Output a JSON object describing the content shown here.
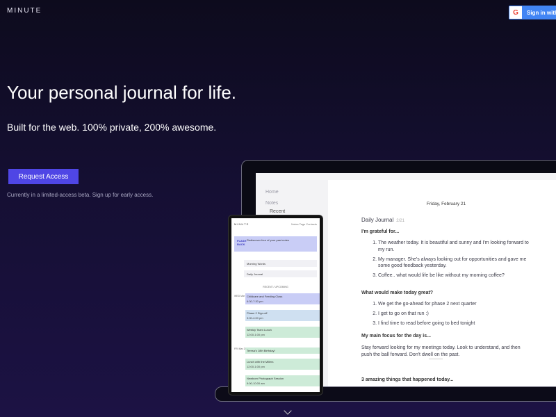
{
  "brand": "MINUTE",
  "signin": {
    "g": "G",
    "label": "Sign in with G"
  },
  "hero": {
    "title": "Your personal journal for life.",
    "subtitle": "Built for the web. 100% private, 200% awesome.",
    "cta": "Request Access",
    "note": "Currently in a limited-access beta. Sign up for early access."
  },
  "laptop": {
    "sidebar": {
      "home": "Home",
      "notes": "Notes",
      "recent": "Recent"
    },
    "doc": {
      "date": "Friday, February 21",
      "title": "Daily Journal",
      "page": "2/21",
      "grateful_heading": "I'm grateful for...",
      "grateful_items": [
        "The weather today. It is beautiful and sunny and I'm looking forward to my run.",
        "My manager. She's always looking out for opportunities and gave me some good feedback yesterday.",
        "Coffee.. what would life be like without my morning coffee?"
      ],
      "great_heading": "What would make today great?",
      "great_items": [
        "We get the go-ahead for phase 2 next quarter",
        "I get to go on that run :)",
        "I find time to read before going to bed tonight"
      ],
      "focus_heading": "My main focus for the day is...",
      "focus_text": "Stay forward looking for my meetings today. Look to understand, and then push the ball forward. Don't dwell on the past.",
      "amazing_heading": "3 amazing things that happened today..."
    }
  },
  "phone": {
    "brand": "MINUTE",
    "nav": "Notes  Tags  Contacts",
    "flashback_label": "FLASH BACK",
    "flashback_text": "Rediscover four of your past notes",
    "row1": "Morning Words",
    "row2": "Daily Journal",
    "tabs": "RECENT / UPCOMING",
    "day1": "WED Mar 23",
    "day2": "FRI Mar 25",
    "events": [
      {
        "title": "Childcare and Feeding Class",
        "time": "6:30-7:30 pm",
        "color": "#c9cdf6"
      },
      {
        "title": "Phase 2 Sign-off",
        "time": "3:00-4:00 pm",
        "color": "#cfe0f1"
      },
      {
        "title": "Weekly Team Lunch",
        "time": "12:00-1:00 pm",
        "color": "#cdebd8"
      },
      {
        "title": "Teresa's 18th Birthday!",
        "time": "",
        "color": "#cdebd8"
      },
      {
        "title": "Lunch with the Millers",
        "time": "12:00-1:00 pm",
        "color": "#cdebd8"
      },
      {
        "title": "Newborn Photograph Session",
        "time": "9:00-10:00 am",
        "color": "#cdebd8"
      }
    ]
  }
}
